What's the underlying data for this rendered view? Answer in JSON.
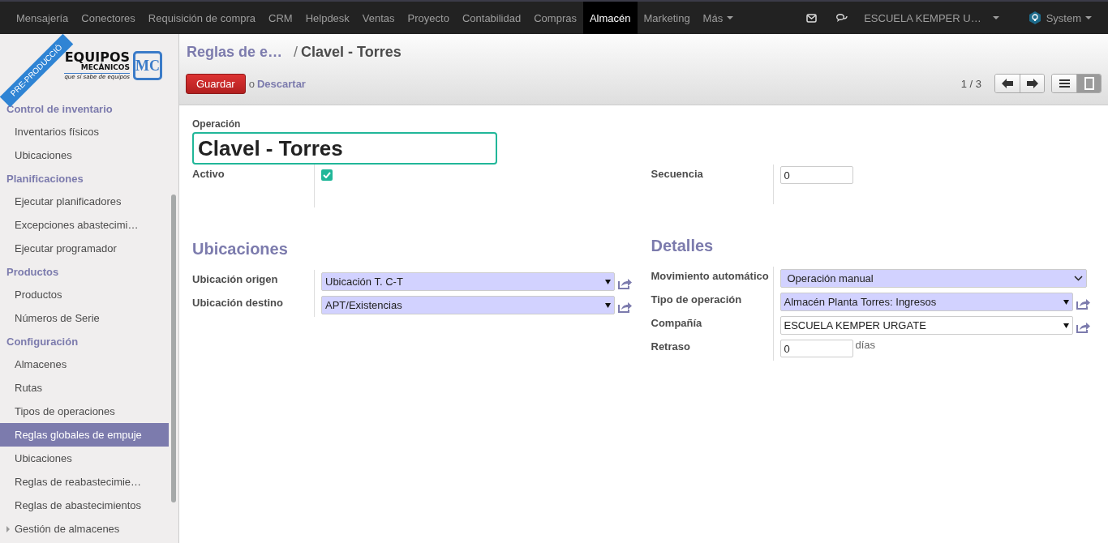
{
  "navbar": {
    "apps": [
      {
        "label": "Mensajería",
        "selected": false
      },
      {
        "label": "Conectores",
        "selected": false
      },
      {
        "label": "Requisición de compra",
        "selected": false
      },
      {
        "label": "CRM",
        "selected": false
      },
      {
        "label": "Helpdesk",
        "selected": false
      },
      {
        "label": "Ventas",
        "selected": false
      },
      {
        "label": "Proyecto",
        "selected": false
      },
      {
        "label": "Contabilidad",
        "selected": false
      },
      {
        "label": "Compras",
        "selected": false
      },
      {
        "label": "Almacén",
        "selected": true
      },
      {
        "label": "Marketing",
        "selected": false
      }
    ],
    "more": "Más",
    "company": "ESCUELA KEMPER U…",
    "user": "System"
  },
  "sidebar": {
    "ribbon": "PRE-PRODUCCIÓ",
    "logo": {
      "line1": "EQUIPOS",
      "line2": "MECÁNICOS",
      "tagline": "que sí sabe de equipos",
      "monogram": "MC"
    },
    "sections": [
      {
        "title": "Control de inventario",
        "items": [
          {
            "label": "Inventarios físicos",
            "selected": false,
            "expandable": false
          },
          {
            "label": "Ubicaciones",
            "selected": false,
            "expandable": false
          }
        ]
      },
      {
        "title": "Planificaciones",
        "items": [
          {
            "label": "Ejecutar planificadores",
            "selected": false,
            "expandable": false
          },
          {
            "label": "Excepciones abastecimi…",
            "selected": false,
            "expandable": false
          },
          {
            "label": "Ejecutar programador",
            "selected": false,
            "expandable": false
          }
        ]
      },
      {
        "title": "Productos",
        "items": [
          {
            "label": "Productos",
            "selected": false,
            "expandable": false
          },
          {
            "label": "Números de Serie",
            "selected": false,
            "expandable": false
          }
        ]
      },
      {
        "title": "Configuración",
        "items": [
          {
            "label": "Almacenes",
            "selected": false,
            "expandable": false
          },
          {
            "label": "Rutas",
            "selected": false,
            "expandable": false
          },
          {
            "label": "Tipos de operaciones",
            "selected": false,
            "expandable": false
          },
          {
            "label": "Reglas globales de empuje",
            "selected": true,
            "expandable": false
          },
          {
            "label": "Ubicaciones",
            "selected": false,
            "expandable": false
          },
          {
            "label": "Reglas de reabastecimie…",
            "selected": false,
            "expandable": false
          },
          {
            "label": "Reglas de abastecimientos",
            "selected": false,
            "expandable": false
          },
          {
            "label": "Gestión de almacenes",
            "selected": false,
            "expandable": true
          }
        ]
      }
    ]
  },
  "control_panel": {
    "breadcrumb": [
      "Reglas de e…",
      "Clavel - Torres"
    ],
    "breadcrumb_separator": "/",
    "save": "Guardar",
    "or": "o",
    "discard": "Descartar",
    "pager": "1 / 3",
    "views": [
      {
        "kind": "list",
        "selected": false
      },
      {
        "kind": "form",
        "selected": true
      }
    ]
  },
  "form": {
    "title_label": "Operación",
    "title_value": "Clavel - Torres",
    "top": [
      [
        {
          "kind": "checkbox",
          "label": "Activo",
          "checked": true
        }
      ],
      [
        {
          "kind": "input",
          "label": "Secuencia",
          "value": "0"
        }
      ]
    ],
    "groups": [
      {
        "title": "Ubicaciones",
        "fields": [
          {
            "kind": "many2one",
            "label": "Ubicación origen",
            "value": "Ubicación T. C-T",
            "required": true
          },
          {
            "kind": "many2one",
            "label": "Ubicación destino",
            "value": "APT/Existencias",
            "required": true
          }
        ]
      },
      {
        "title": "Detalles",
        "fields": [
          {
            "kind": "selection",
            "label": "Movimiento automático",
            "value": "Operación manual",
            "required": true
          },
          {
            "kind": "many2one",
            "label": "Tipo de operación",
            "value": "Almacén Planta Torres: Ingresos",
            "required": true
          },
          {
            "kind": "many2one",
            "label": "Compañía",
            "value": "ESCUELA KEMPER URGATE",
            "required": false
          },
          {
            "kind": "input",
            "label": "Retraso",
            "value": "0",
            "suffix": "días"
          }
        ]
      }
    ]
  }
}
